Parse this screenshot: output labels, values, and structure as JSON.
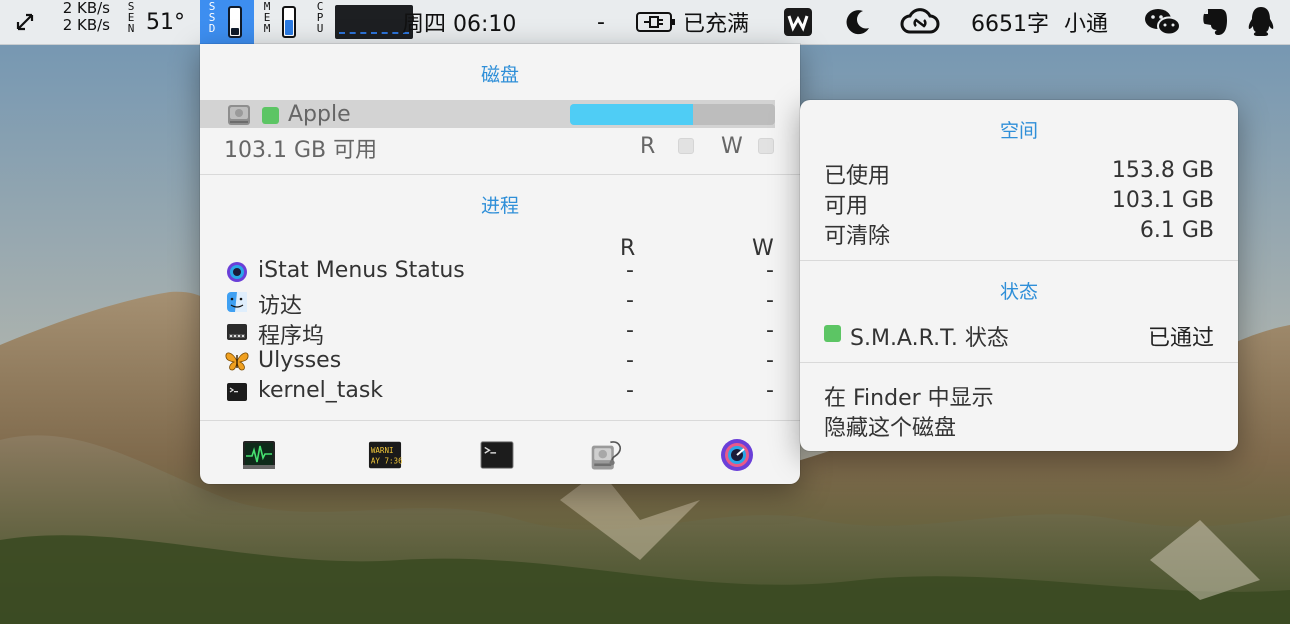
{
  "menubar": {
    "net_up": "2 KB/s",
    "net_down": "2 KB/s",
    "sensor_label": "SEN",
    "temperature": "51°",
    "ssd_label": "SSD",
    "mem_label": "MEM",
    "cpu_label": "CPU",
    "clock": "周四 06:10",
    "dash": "-",
    "battery_status": "已充满",
    "word_count": "6651字",
    "user_name": "小通",
    "ssd_level": 0.25,
    "mem_level": 0.55,
    "colors": {
      "accent": "#3d8ef0"
    },
    "icons": [
      "resize-arrows-icon",
      "wps-icon",
      "moon-icon",
      "creative-cloud-icon",
      "wechat-icon",
      "evernote-icon",
      "qq-icon",
      "battery-plug-icon"
    ]
  },
  "disk_panel": {
    "title": "磁盘",
    "disk": {
      "name": "Apple",
      "free_text": "103.1 GB 可用",
      "usage_fraction": 0.6,
      "read_label": "R",
      "write_label": "W"
    },
    "processes_title": "进程",
    "col_read": "R",
    "col_write": "W",
    "processes": [
      {
        "name": "iStat Menus Status",
        "read": "-",
        "write": "-",
        "icon": "istat-icon"
      },
      {
        "name": "访达",
        "read": "-",
        "write": "-",
        "icon": "finder-icon"
      },
      {
        "name": "程序坞",
        "read": "-",
        "write": "-",
        "icon": "dock-icon"
      },
      {
        "name": "Ulysses",
        "read": "-",
        "write": "-",
        "icon": "butterfly-icon"
      },
      {
        "name": "kernel_task",
        "read": "-",
        "write": "-",
        "icon": "terminal-icon"
      }
    ],
    "toolbar_icons": [
      "activity-monitor-icon",
      "console-icon",
      "terminal-icon",
      "disk-utility-icon",
      "istat-menus-icon"
    ],
    "colors": {
      "accent": "#2f8fd8",
      "usage_bar": "#4fcdf5",
      "status_green": "#5cc564"
    }
  },
  "side_panel": {
    "space_title": "空间",
    "space_rows": [
      {
        "label": "已使用",
        "value": "153.8 GB"
      },
      {
        "label": "可用",
        "value": "103.1 GB"
      },
      {
        "label": "可清除",
        "value": "6.1 GB"
      }
    ],
    "status_title": "状态",
    "smart_label": "S.M.A.R.T. 状态",
    "smart_value": "已通过",
    "actions": [
      "在 Finder 中显示",
      "隐藏这个磁盘"
    ]
  }
}
